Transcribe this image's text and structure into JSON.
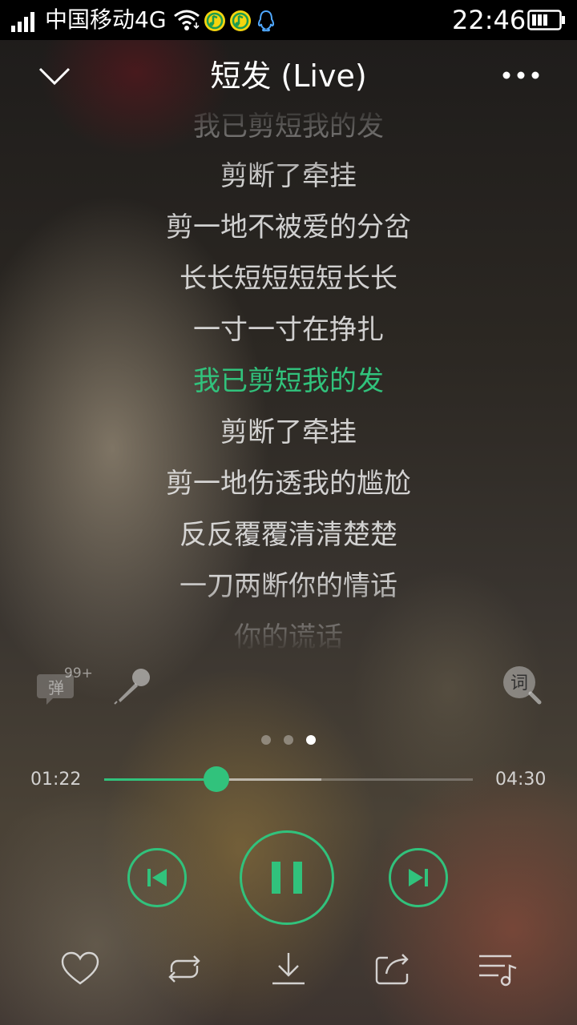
{
  "status_bar": {
    "carrier": "中国移动4G",
    "time": "22:46",
    "icons": [
      "signal-icon",
      "wifi-icon",
      "qq-music-icon",
      "qq-music-icon",
      "qq-icon",
      "battery-icon"
    ]
  },
  "header": {
    "title": "短发 (Live)",
    "collapse_icon": "chevron-down-icon",
    "more_icon": "more-icon"
  },
  "lyrics": {
    "lines": [
      "我已剪短我的发",
      "剪断了牵挂",
      "剪一地不被爱的分岔",
      "长长短短短短长长",
      "一寸一寸在挣扎",
      "我已剪短我的发",
      "剪断了牵挂",
      "剪一地伤透我的尴尬",
      "反反覆覆清清楚楚",
      "一刀两断你的情话",
      "你的谎话"
    ],
    "current_index": 5
  },
  "tools": {
    "danmu_label": "弹",
    "danmu_count": "99+",
    "lyric_search_label": "词"
  },
  "pager": {
    "pages": 3,
    "active_index": 2
  },
  "player": {
    "elapsed": "01:22",
    "total": "04:30",
    "progress": 0.3037,
    "buffered": 0.59,
    "state": "playing"
  },
  "bottom_actions": [
    {
      "name": "favorite-button",
      "icon": "heart-icon"
    },
    {
      "name": "repeat-mode-button",
      "icon": "repeat-icon"
    },
    {
      "name": "download-button",
      "icon": "download-icon"
    },
    {
      "name": "share-button",
      "icon": "share-icon"
    },
    {
      "name": "playlist-button",
      "icon": "playlist-icon"
    }
  ],
  "colors": {
    "accent": "#31c27c",
    "lyric": "#e8e8e8",
    "status_bar_bg": "#000000"
  }
}
